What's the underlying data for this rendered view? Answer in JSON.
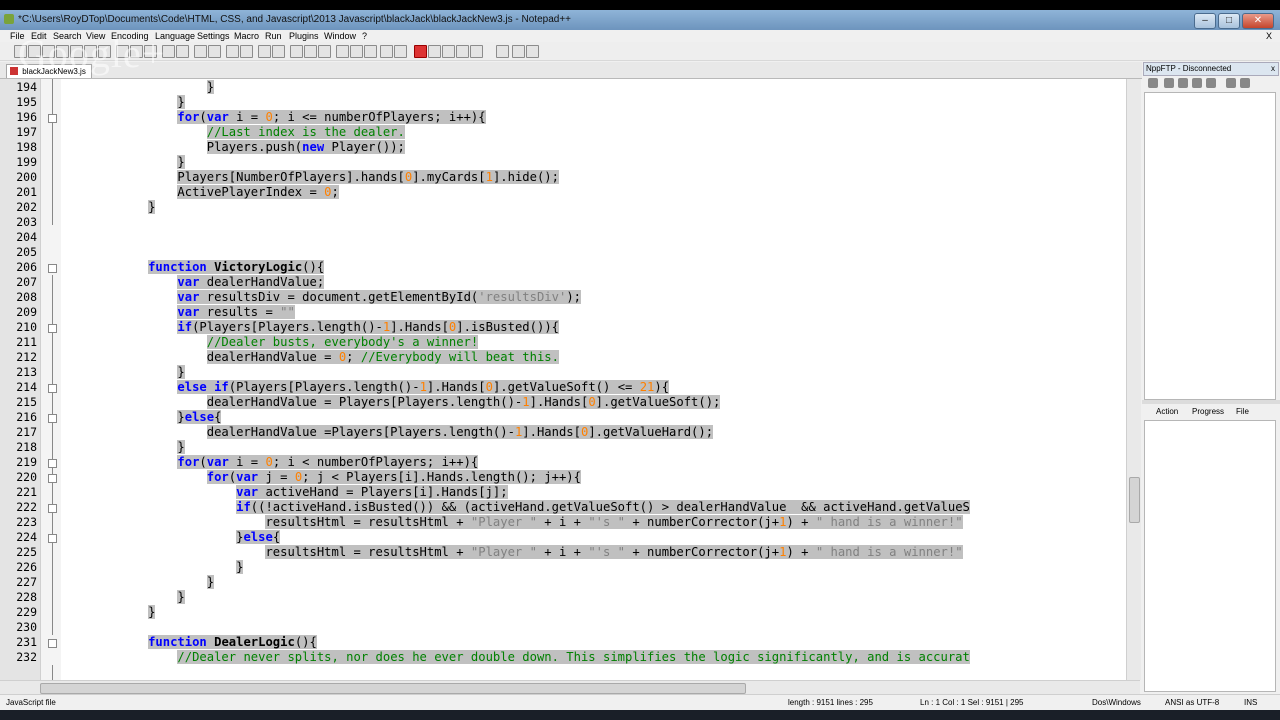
{
  "window": {
    "title": "*C:\\Users\\RoyDTop\\Documents\\Code\\HTML, CSS, and Javascript\\2013 Javascript\\blackJack\\blackJackNew3.js - Notepad++",
    "minimize": "–",
    "maximize": "□",
    "close": "✕"
  },
  "menu": {
    "items": [
      "File",
      "Edit",
      "Search",
      "View",
      "Encoding",
      "Language",
      "Settings",
      "Macro",
      "Run",
      "Plugins",
      "Window",
      "?"
    ],
    "close_doc": "X"
  },
  "tab": {
    "label": "blackJackNew3.js"
  },
  "watermark": "Google+",
  "editor": {
    "lines": [
      {
        "n": "194",
        "segs": [
          [
            "                    ",
            ""
          ],
          [
            "}",
            "sel"
          ]
        ]
      },
      {
        "n": "195",
        "segs": [
          [
            "                ",
            ""
          ],
          [
            "}",
            "sel"
          ]
        ]
      },
      {
        "n": "196",
        "segs": [
          [
            "                ",
            ""
          ],
          [
            "for",
            "kw"
          ],
          [
            "(",
            "sel"
          ],
          [
            "var",
            "kw"
          ],
          [
            " i = ",
            "sel"
          ],
          [
            "0",
            "nm"
          ],
          [
            "; i <= numberOfPlayers; i++){",
            "sel"
          ]
        ]
      },
      {
        "n": "197",
        "segs": [
          [
            "                    ",
            ""
          ],
          [
            "//Last index is the dealer.",
            "cm"
          ]
        ]
      },
      {
        "n": "198",
        "segs": [
          [
            "                    ",
            ""
          ],
          [
            "Players.push(",
            "sel"
          ],
          [
            "new",
            "kw"
          ],
          [
            " Player());",
            "sel"
          ]
        ]
      },
      {
        "n": "199",
        "segs": [
          [
            "                ",
            ""
          ],
          [
            "}",
            "sel"
          ]
        ]
      },
      {
        "n": "200",
        "segs": [
          [
            "                ",
            ""
          ],
          [
            "Players[NumberOfPlayers].hands[",
            "sel"
          ],
          [
            "0",
            "nm"
          ],
          [
            "].myCards[",
            "sel"
          ],
          [
            "1",
            "nm"
          ],
          [
            "].hide();",
            "sel"
          ]
        ]
      },
      {
        "n": "201",
        "segs": [
          [
            "                ",
            ""
          ],
          [
            "ActivePlayerIndex = ",
            "sel"
          ],
          [
            "0",
            "nm"
          ],
          [
            ";",
            "sel"
          ]
        ]
      },
      {
        "n": "202",
        "segs": [
          [
            "            ",
            ""
          ],
          [
            "}",
            "sel"
          ]
        ]
      },
      {
        "n": "203",
        "segs": []
      },
      {
        "n": "204",
        "segs": []
      },
      {
        "n": "205",
        "segs": []
      },
      {
        "n": "206",
        "segs": [
          [
            "            ",
            ""
          ],
          [
            "function",
            "kw"
          ],
          [
            " ",
            "sel"
          ],
          [
            "VictoryLogic",
            "fn"
          ],
          [
            "(){",
            "sel"
          ]
        ]
      },
      {
        "n": "207",
        "segs": [
          [
            "                ",
            ""
          ],
          [
            "var",
            "kw"
          ],
          [
            " dealerHandValue;",
            "sel"
          ]
        ]
      },
      {
        "n": "208",
        "segs": [
          [
            "                ",
            ""
          ],
          [
            "var",
            "kw"
          ],
          [
            " resultsDiv = document.getElementById(",
            "sel"
          ],
          [
            "'resultsDiv'",
            "st"
          ],
          [
            ");",
            "sel"
          ]
        ]
      },
      {
        "n": "209",
        "segs": [
          [
            "                ",
            ""
          ],
          [
            "var",
            "kw"
          ],
          [
            " results = ",
            "sel"
          ],
          [
            "\"\"",
            "st"
          ]
        ]
      },
      {
        "n": "210",
        "segs": [
          [
            "                ",
            ""
          ],
          [
            "if",
            "kw"
          ],
          [
            "(Players[Players.length()-",
            "sel"
          ],
          [
            "1",
            "nm"
          ],
          [
            "].Hands[",
            "sel"
          ],
          [
            "0",
            "nm"
          ],
          [
            "].isBusted()){",
            "sel"
          ]
        ]
      },
      {
        "n": "211",
        "segs": [
          [
            "                    ",
            ""
          ],
          [
            "//Dealer busts, everybody's a winner!",
            "cm"
          ]
        ]
      },
      {
        "n": "212",
        "segs": [
          [
            "                    ",
            ""
          ],
          [
            "dealerHandValue = ",
            "sel"
          ],
          [
            "0",
            "nm"
          ],
          [
            "; ",
            "sel"
          ],
          [
            "//Everybody will beat this.",
            "cm"
          ]
        ]
      },
      {
        "n": "213",
        "segs": [
          [
            "                ",
            ""
          ],
          [
            "}",
            "sel"
          ]
        ]
      },
      {
        "n": "214",
        "segs": [
          [
            "                ",
            ""
          ],
          [
            "else if",
            "kw"
          ],
          [
            "(Players[Players.length()-",
            "sel"
          ],
          [
            "1",
            "nm"
          ],
          [
            "].Hands[",
            "sel"
          ],
          [
            "0",
            "nm"
          ],
          [
            "].getValueSoft() <= ",
            "sel"
          ],
          [
            "21",
            "nm"
          ],
          [
            "){",
            "sel"
          ]
        ]
      },
      {
        "n": "215",
        "segs": [
          [
            "                    ",
            ""
          ],
          [
            "dealerHandValue = Players[Players.length()-",
            "sel"
          ],
          [
            "1",
            "nm"
          ],
          [
            "].Hands[",
            "sel"
          ],
          [
            "0",
            "nm"
          ],
          [
            "].getValueSoft();",
            "sel"
          ]
        ]
      },
      {
        "n": "216",
        "segs": [
          [
            "                ",
            ""
          ],
          [
            "}",
            "sel"
          ],
          [
            "else",
            "kw"
          ],
          [
            "{",
            "sel"
          ]
        ]
      },
      {
        "n": "217",
        "segs": [
          [
            "                    ",
            ""
          ],
          [
            "dealerHandValue =Players[Players.length()-",
            "sel"
          ],
          [
            "1",
            "nm"
          ],
          [
            "].Hands[",
            "sel"
          ],
          [
            "0",
            "nm"
          ],
          [
            "].getValueHard();",
            "sel"
          ]
        ]
      },
      {
        "n": "218",
        "segs": [
          [
            "                ",
            ""
          ],
          [
            "}",
            "sel"
          ]
        ]
      },
      {
        "n": "219",
        "segs": [
          [
            "                ",
            ""
          ],
          [
            "for",
            "kw"
          ],
          [
            "(",
            "sel"
          ],
          [
            "var",
            "kw"
          ],
          [
            " i = ",
            "sel"
          ],
          [
            "0",
            "nm"
          ],
          [
            "; i < numberOfPlayers; i++){",
            "sel"
          ]
        ]
      },
      {
        "n": "220",
        "segs": [
          [
            "                    ",
            ""
          ],
          [
            "for",
            "kw"
          ],
          [
            "(",
            "sel"
          ],
          [
            "var",
            "kw"
          ],
          [
            " j = ",
            "sel"
          ],
          [
            "0",
            "nm"
          ],
          [
            "; j < Players[i].Hands.length(); j++){",
            "sel"
          ]
        ]
      },
      {
        "n": "221",
        "segs": [
          [
            "                        ",
            ""
          ],
          [
            "var",
            "kw"
          ],
          [
            " activeHand = Players[i].Hands[j];",
            "sel"
          ]
        ]
      },
      {
        "n": "222",
        "segs": [
          [
            "                        ",
            ""
          ],
          [
            "if",
            "kw"
          ],
          [
            "((!activeHand.isBusted()) && (activeHand.getValueSoft() > dealerHandValue  && activeHand.getValueS",
            "sel"
          ]
        ]
      },
      {
        "n": "223",
        "segs": [
          [
            "                            ",
            ""
          ],
          [
            "resultsHtml = resultsHtml + ",
            "sel"
          ],
          [
            "\"Player \"",
            "st"
          ],
          [
            " + i + ",
            "sel"
          ],
          [
            "\"'s \"",
            "st"
          ],
          [
            " + numberCorrector(j+",
            "sel"
          ],
          [
            "1",
            "nm"
          ],
          [
            ") + ",
            "sel"
          ],
          [
            "\" hand is a winner!\"",
            "st"
          ]
        ]
      },
      {
        "n": "224",
        "segs": [
          [
            "                        ",
            ""
          ],
          [
            "}",
            "sel"
          ],
          [
            "else",
            "kw"
          ],
          [
            "{",
            "sel"
          ]
        ]
      },
      {
        "n": "225",
        "segs": [
          [
            "                            ",
            ""
          ],
          [
            "resultsHtml = resultsHtml + ",
            "sel"
          ],
          [
            "\"Player \"",
            "st"
          ],
          [
            " + i + ",
            "sel"
          ],
          [
            "\"'s \"",
            "st"
          ],
          [
            " + numberCorrector(j+",
            "sel"
          ],
          [
            "1",
            "nm"
          ],
          [
            ") + ",
            "sel"
          ],
          [
            "\" hand is a winner!\"",
            "st"
          ]
        ]
      },
      {
        "n": "226",
        "segs": [
          [
            "                        ",
            ""
          ],
          [
            "}",
            "sel"
          ]
        ]
      },
      {
        "n": "227",
        "segs": [
          [
            "                    ",
            ""
          ],
          [
            "}",
            "sel"
          ]
        ]
      },
      {
        "n": "228",
        "segs": [
          [
            "                ",
            ""
          ],
          [
            "}",
            "sel"
          ]
        ]
      },
      {
        "n": "229",
        "segs": [
          [
            "            ",
            ""
          ],
          [
            "}",
            "sel"
          ]
        ]
      },
      {
        "n": "230",
        "segs": []
      },
      {
        "n": "231",
        "segs": [
          [
            "            ",
            ""
          ],
          [
            "function",
            "kw"
          ],
          [
            " ",
            "sel"
          ],
          [
            "DealerLogic",
            "fn"
          ],
          [
            "(){",
            "sel"
          ]
        ]
      },
      {
        "n": "232",
        "segs": [
          [
            "                ",
            ""
          ],
          [
            "//Dealer never splits, nor does he ever double down. This simplifies the logic significantly, and is accurat",
            "cm"
          ]
        ]
      }
    ],
    "fold_lines": [
      "196",
      "206",
      "210",
      "214",
      "216",
      "219",
      "220",
      "222",
      "224",
      "231"
    ]
  },
  "side_panel": {
    "title": "NppFTP - Disconnected",
    "close": "x",
    "tabs": [
      "Action",
      "Progress",
      "File"
    ]
  },
  "status": {
    "filetype": "JavaScript file",
    "length": "length : 9151    lines : 295",
    "position": "Ln : 1    Col : 1    Sel : 9151 | 295",
    "eol": "Dos\\Windows",
    "encoding": "ANSI as UTF-8",
    "mode": "INS"
  }
}
